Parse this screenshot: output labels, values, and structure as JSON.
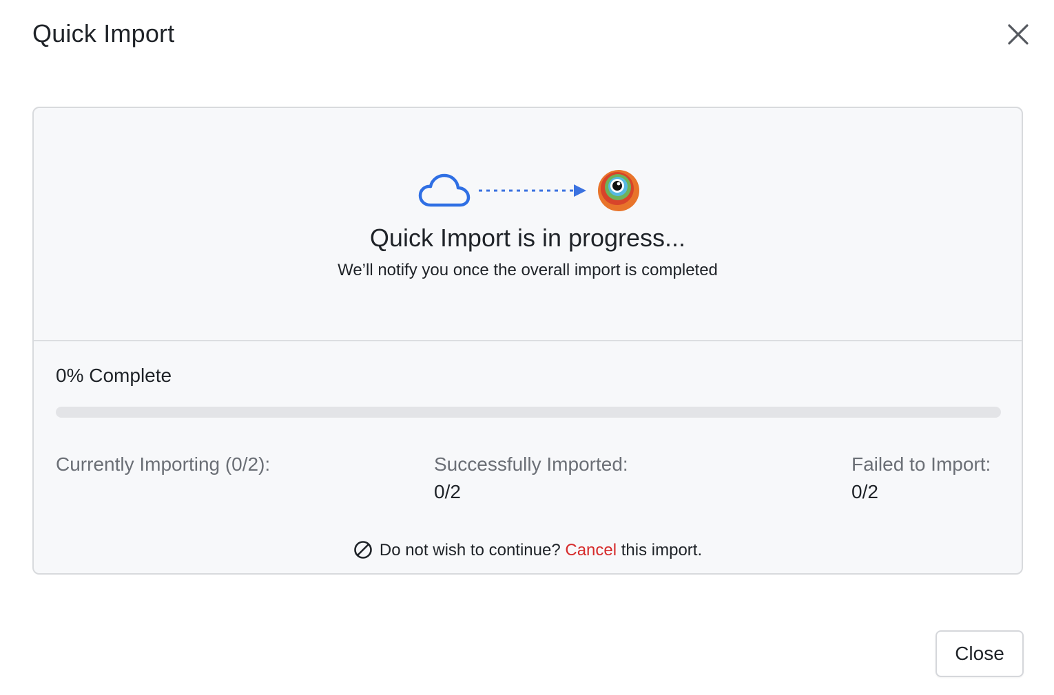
{
  "dialog": {
    "title": "Quick Import",
    "close_icon": "close-icon"
  },
  "status": {
    "source_icon": "cloud-icon",
    "arrow_icon": "dotted-arrow-icon",
    "target_icon": "app-logo-icon",
    "title": "Quick Import is in progress...",
    "subtitle": "We’ll notify you once the overall import is completed"
  },
  "progress": {
    "label": "0% Complete",
    "percent": 0,
    "bar_color": "#3b72e0"
  },
  "stats": {
    "currently_importing_label": "Currently Importing (0/2):",
    "success_label": "Successfully Imported:",
    "success_value": "0/2",
    "failed_label": "Failed to Import:",
    "failed_value": "0/2"
  },
  "cancel": {
    "icon": "ban-icon",
    "prefix": "Do not wish to continue?",
    "link": "Cancel",
    "suffix": "this import.",
    "link_color": "#d62b2b"
  },
  "footer": {
    "close_label": "Close"
  },
  "colors": {
    "accent": "#3b72e0",
    "danger": "#d62b2b",
    "panel_bg": "#f7f8fa"
  }
}
